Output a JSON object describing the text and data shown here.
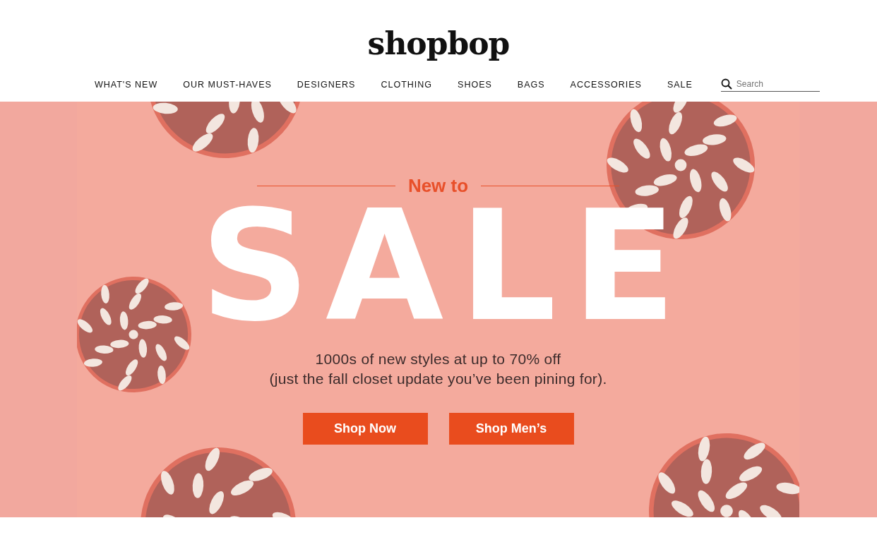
{
  "logo": "shopbop",
  "nav": [
    {
      "label": "WHAT'S NEW"
    },
    {
      "label": "OUR MUST-HAVES"
    },
    {
      "label": "DESIGNERS"
    },
    {
      "label": "CLOTHING"
    },
    {
      "label": "SHOES"
    },
    {
      "label": "BAGS"
    },
    {
      "label": "ACCESSORIES"
    },
    {
      "label": "SALE"
    }
  ],
  "search": {
    "placeholder": "Search"
  },
  "banner": {
    "kicker": "New to",
    "headline": "SALE",
    "text_lines": [
      "1000s of new styles at up to 70% off",
      "(just the fall closet update you’ve been pining for)."
    ],
    "buttons": [
      "Shop Now",
      "Shop Men’s"
    ]
  }
}
